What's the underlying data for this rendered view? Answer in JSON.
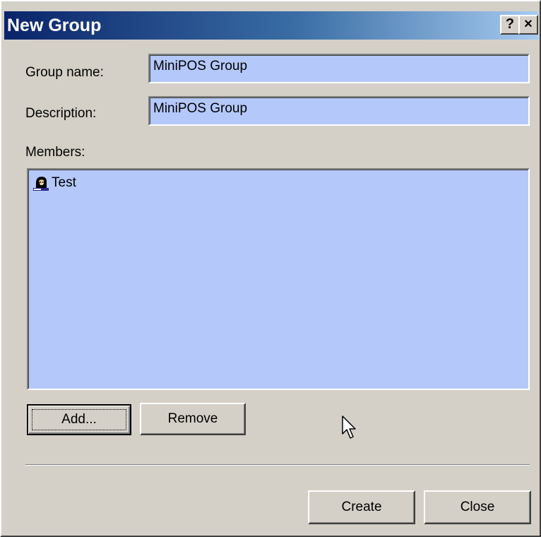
{
  "window": {
    "title": "New Group",
    "help_glyph": "?",
    "close_glyph": "×"
  },
  "form": {
    "group_name_label": "Group name:",
    "group_name_value": "MiniPOS Group",
    "description_label": "Description:",
    "description_value": "MiniPOS Group",
    "members_label": "Members:",
    "members": [
      {
        "icon": "user-icon",
        "name": "Test"
      }
    ]
  },
  "buttons": {
    "add": "Add...",
    "remove": "Remove",
    "create": "Create",
    "close": "Close"
  },
  "colors": {
    "dialog_face": "#d4d0c8",
    "field_fill": "#b4c8fa",
    "title_gradient_start": "#0a246a",
    "title_gradient_end": "#a6caf0"
  }
}
